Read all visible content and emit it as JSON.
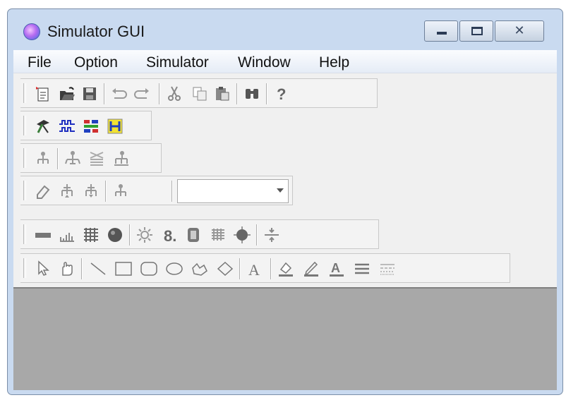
{
  "window": {
    "title": "Simulator GUI"
  },
  "menu": [
    "File",
    "Option",
    "Simulator",
    "Window",
    "Help"
  ],
  "toolbars": {
    "standard": [
      "new-file-icon",
      "open-folder-icon",
      "save-icon",
      "undo-icon",
      "redo-icon",
      "cut-icon",
      "copy-icon",
      "paste-icon",
      "find-icon",
      "help-icon"
    ],
    "simulator": [
      "simulator-run-icon",
      "waveform-icon",
      "schematic-icon",
      "bracket-icon"
    ],
    "tree": [
      "tree-root-icon",
      "tree-expand-icon",
      "tree-collapse-icon",
      "tree-merge-icon"
    ],
    "edit": [
      "eraser-icon",
      "move-up-icon",
      "move-down-icon",
      "tree-node-icon"
    ],
    "view": [
      "bar-icon",
      "chart-icon",
      "grid-icon",
      "circle-icon",
      "sun-icon",
      "digit-icon",
      "pattern-icon",
      "matrix-icon",
      "star-icon",
      "align-icon"
    ],
    "draw": [
      "select-arrow-icon",
      "hand-icon",
      "line-icon",
      "rectangle-icon",
      "rounded-rectangle-icon",
      "ellipse-icon",
      "freeform-icon",
      "polygon-icon",
      "text-icon",
      "fill-color-icon",
      "line-color-icon",
      "font-color-icon",
      "line-weight-icon",
      "line-style-icon"
    ]
  },
  "combo": {
    "value": ""
  }
}
